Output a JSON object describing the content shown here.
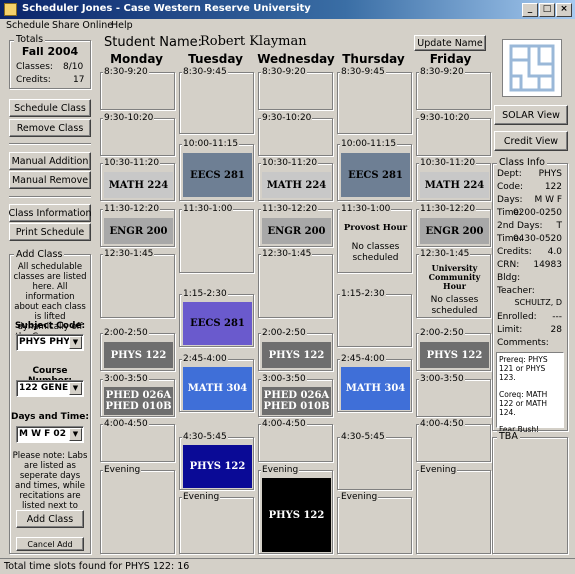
{
  "window": {
    "title": "Scheduler Jones - Case Western Reserve University",
    "min": "_",
    "max": "□",
    "close": "×"
  },
  "menu": {
    "schedule": "Schedule",
    "share": "Share Online",
    "help": "Help"
  },
  "totals": {
    "label": "Totals",
    "term": "Fall 2004",
    "classes_label": "Classes:",
    "classes_value": "8/10",
    "credits_label": "Credits:",
    "credits_value": "17"
  },
  "buttons": {
    "schedule_class": "Schedule Class",
    "remove_class": "Remove Class",
    "manual_addition": "Manual Addition",
    "manual_remove": "Manual Remove",
    "class_information": "Class Information",
    "print_schedule": "Print Schedule",
    "add_class": "Add Class",
    "cancel_add": "Cancel Add",
    "update_name": "Update Name",
    "solar_view": "SOLAR View",
    "credit_view": "Credit View"
  },
  "add_class": {
    "label": "Add Class",
    "description": "All schedulable classes are listed here. All information about each class is lifted dynamically off the Case server.",
    "subject_label": "Subject Code:",
    "subject_value": "PHYS PHY",
    "course_label": "Course Number:",
    "course_value": "122 GENE",
    "days_label": "Days and Time:",
    "days_value": "M W F 02",
    "note": "Please note: Labs are listed as seperate days and times, while recitations are listed next to main times."
  },
  "student": {
    "label": "Student Name:",
    "name": "Robert Klayman"
  },
  "days": [
    "Monday",
    "Tuesday",
    "Wednesday",
    "Thursday",
    "Friday"
  ],
  "class_info": {
    "label": "Class Info",
    "dept_label": "Dept:",
    "dept": "PHYS",
    "code_label": "Code:",
    "code": "122",
    "days_label": "Days:",
    "days": "M W F",
    "time_label": "Time:",
    "time": "0200-0250",
    "days2_label": "2nd Days:",
    "days2": "T",
    "time2_label": "Time:",
    "time2": "0430-0520",
    "credits_label": "Credits:",
    "credits": "4.0",
    "crn_label": "CRN:",
    "crn": "14983",
    "bldg_label": "Bldg:",
    "bldg": "",
    "teacher_label": "Teacher:",
    "teacher": "SCHULTZ, D",
    "enrolled_label": "Enrolled:",
    "enrolled": "---",
    "limit_label": "Limit:",
    "limit": "28",
    "comments_label": "Comments:",
    "comments_1": "Prereq: PHYS 121 or PHYS 123.",
    "comments_2": "Coreq: MATH 122 or MATH 124.",
    "comments_3": "Fear Bush!"
  },
  "tba": {
    "label": "TBA"
  },
  "status": "Total time slots found for PHYS 122: 16",
  "schedule": {
    "mon": [
      {
        "time": "8:30-9:20",
        "cls": ""
      },
      {
        "time": "9:30-10:20",
        "cls": ""
      },
      {
        "time": "10:30-11:20",
        "cls": "MATH 224"
      },
      {
        "time": "11:30-12:20",
        "cls": "ENGR 200"
      },
      {
        "time": "12:30-1:45",
        "cls": ""
      },
      {
        "time": "2:00-2:50",
        "cls": "PHYS 122"
      },
      {
        "time": "3:00-3:50",
        "cls": "PHED 026A PHED 010B"
      },
      {
        "time": "4:00-4:50",
        "cls": ""
      },
      {
        "time": "Evening",
        "cls": ""
      }
    ],
    "tue": [
      {
        "time": "8:30-9:45",
        "cls": ""
      },
      {
        "time": "10:00-11:15",
        "cls": "EECS 281"
      },
      {
        "time": "11:30-1:00",
        "cls": ""
      },
      {
        "time": "1:15-2:30",
        "cls": "EECS 281"
      },
      {
        "time": "2:45-4:00",
        "cls": "MATH 304"
      },
      {
        "time": "4:30-5:45",
        "cls": "PHYS 122"
      },
      {
        "time": "Evening",
        "cls": ""
      }
    ],
    "wed": [
      {
        "time": "8:30-9:20",
        "cls": ""
      },
      {
        "time": "9:30-10:20",
        "cls": ""
      },
      {
        "time": "10:30-11:20",
        "cls": "MATH 224"
      },
      {
        "time": "11:30-12:20",
        "cls": "ENGR 200"
      },
      {
        "time": "12:30-1:45",
        "cls": ""
      },
      {
        "time": "2:00-2:50",
        "cls": "PHYS 122"
      },
      {
        "time": "3:00-3:50",
        "cls": "PHED 026A PHED 010B"
      },
      {
        "time": "4:00-4:50",
        "cls": ""
      },
      {
        "time": "Evening",
        "cls": "PHYS 122"
      }
    ],
    "thu": [
      {
        "time": "8:30-9:45",
        "cls": ""
      },
      {
        "time": "10:00-11:15",
        "cls": "EECS 281"
      },
      {
        "time": "11:30-1:00",
        "title": "Provost Hour",
        "note": "No classes scheduled"
      },
      {
        "time": "1:15-2:30",
        "cls": ""
      },
      {
        "time": "2:45-4:00",
        "cls": "MATH 304"
      },
      {
        "time": "4:30-5:45",
        "cls": ""
      },
      {
        "time": "Evening",
        "cls": ""
      }
    ],
    "fri": [
      {
        "time": "8:30-9:20",
        "cls": ""
      },
      {
        "time": "9:30-10:20",
        "cls": ""
      },
      {
        "time": "10:30-11:20",
        "cls": "MATH 224"
      },
      {
        "time": "11:30-12:20",
        "cls": "ENGR 200"
      },
      {
        "time": "12:30-1:45",
        "title": "University Community Hour",
        "note": "No classes scheduled"
      },
      {
        "time": "2:00-2:50",
        "cls": "PHYS 122"
      },
      {
        "time": "3:00-3:50",
        "cls": ""
      },
      {
        "time": "4:00-4:50",
        "cls": ""
      },
      {
        "time": "Evening",
        "cls": ""
      }
    ]
  },
  "colors": {
    "math224": "#c8c8c8",
    "engr200": "#a8a8a8",
    "eecs281a": "#6e7f94",
    "eecs281b": "#6a5acd",
    "math304": "#3f6fd8",
    "phys122_gray": "#6e6e6e",
    "phys122_blue": "#0a0a96",
    "phys122_black": "#000000",
    "phed": "#6e6e6e"
  }
}
